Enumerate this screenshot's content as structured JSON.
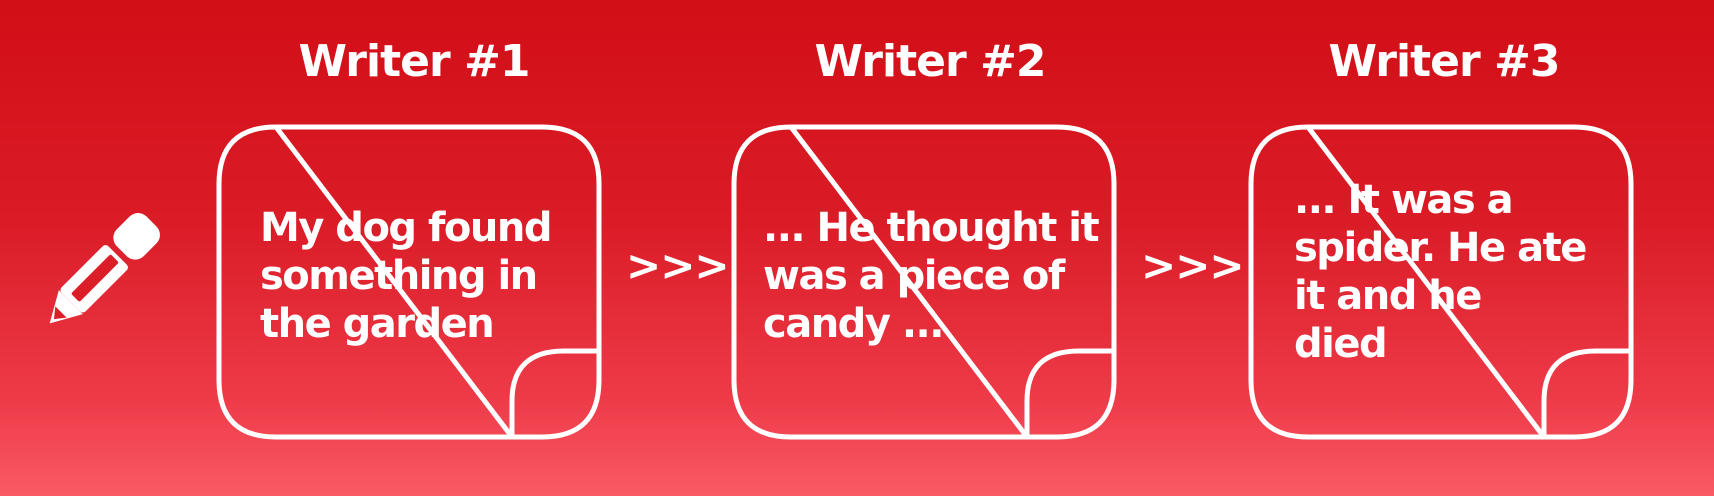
{
  "writers": [
    {
      "title": "Writer #1",
      "text_lines": [
        "My dog found",
        "something in",
        "the garden"
      ]
    },
    {
      "title": "Writer #2",
      "text_lines": [
        "... He thought it",
        "was a piece of",
        "candy ..."
      ]
    },
    {
      "title": "Writer #3",
      "text_lines": [
        "... It was a",
        "spider. He ate",
        "it and he",
        "died"
      ]
    }
  ],
  "arrow_text": ">>>",
  "icons": {
    "start": "pencil-icon"
  },
  "colors": {
    "background_top": "#d20e16",
    "background_bottom": "#f95a63",
    "foreground": "#ffffff"
  }
}
